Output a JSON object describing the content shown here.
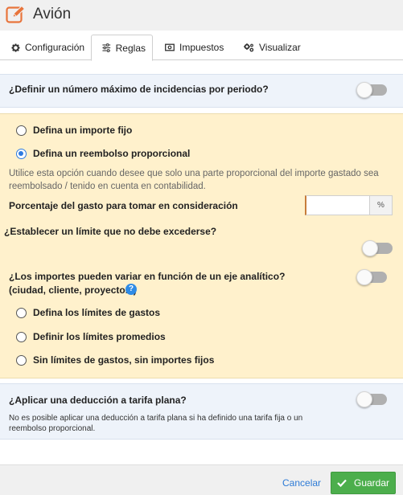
{
  "window": {
    "title": "Avión",
    "icon": "edit-icon"
  },
  "tabs": [
    {
      "label": "Configuración",
      "icon": "gear-icon",
      "active": false
    },
    {
      "label": "Reglas",
      "icon": "sliders-icon",
      "active": true
    },
    {
      "label": "Impuestos",
      "icon": "money-icon",
      "active": false
    },
    {
      "label": "Visualizar",
      "icon": "gears-icon",
      "active": false
    }
  ],
  "rules": {
    "max_incidents": {
      "label": "¿Definir un número máximo de incidencias por periodo?",
      "enabled": false
    },
    "amount_type": {
      "options": [
        {
          "label": "Defina un importe fijo",
          "selected": false
        },
        {
          "label": "Defina un reembolso proporcional",
          "selected": true
        }
      ],
      "hint": "Utilice esta opción cuando desee que solo una parte proporcional del importe gastado sea reembolsado / tenido en cuenta en contabilidad."
    },
    "percentage": {
      "label": "Porcentaje del gasto para tomar en consideración",
      "value": "",
      "unit": "%"
    },
    "limit": {
      "label": "¿Establecer un límite que no debe excederse?",
      "enabled": false
    },
    "analytic": {
      "label": "¿Los importes pueden variar en función de un eje analítico?",
      "sublabel": "(ciudad, cliente, proyecto...)",
      "help_icon": "question-icon",
      "enabled": false,
      "options": [
        {
          "label": "Defina los límites de gastos",
          "selected": false
        },
        {
          "label": "Definir los límites promedios",
          "selected": false
        },
        {
          "label": "Sin límites de gastos, sin importes fijos",
          "selected": false
        }
      ]
    },
    "flat_rate": {
      "label": "¿Aplicar una deducción a tarifa plana?",
      "enabled": false,
      "note": "No es posible aplicar una deducción a tarifa plana si ha definido una tarifa fija o un reembolso proporcional."
    }
  },
  "footer": {
    "cancel_label": "Cancelar",
    "save_label": "Guardar",
    "save_icon": "check-icon"
  },
  "colors": {
    "accent": "#2e7be0",
    "save": "#4cae4c",
    "edit_icon": "#e8743b",
    "highlight_bg": "#fff1cc",
    "section_bg": "#eef3fa"
  }
}
